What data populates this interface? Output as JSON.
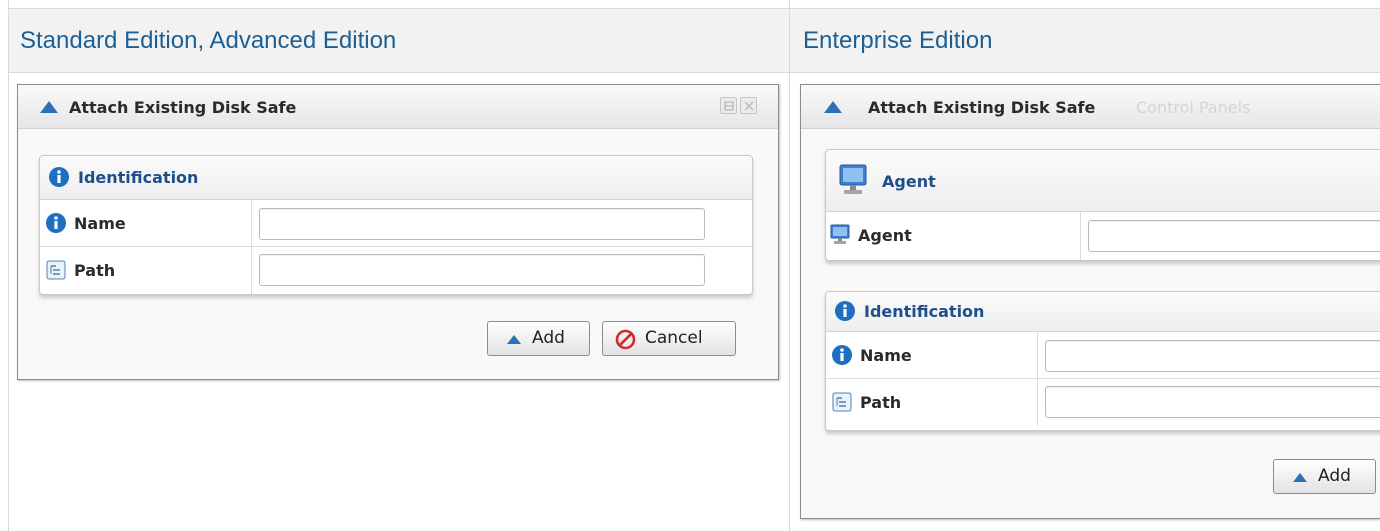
{
  "columns": [
    {
      "header": "Standard Edition, Advanced Edition",
      "dialog": {
        "title": "Attach Existing Disk Safe",
        "section": {
          "title": "Identification",
          "fields": [
            {
              "label": "Name",
              "value": "",
              "icon": "info-icon"
            },
            {
              "label": "Path",
              "value": "",
              "icon": "path-icon"
            }
          ]
        },
        "buttons": {
          "add": "Add",
          "cancel": "Cancel"
        }
      }
    },
    {
      "header": "Enterprise Edition",
      "dialog": {
        "title": "Attach Existing Disk Safe",
        "background_ghost_text": "Control Panels",
        "agent_section": {
          "title": "Agent",
          "fields": [
            {
              "label": "Agent",
              "value": "",
              "icon": "computer-icon"
            }
          ]
        },
        "section": {
          "title": "Identification",
          "fields": [
            {
              "label": "Name",
              "value": "",
              "icon": "info-icon"
            },
            {
              "label": "Path",
              "value": "",
              "icon": "path-icon"
            }
          ]
        },
        "buttons": {
          "add": "Add"
        }
      }
    }
  ],
  "colors": {
    "header_text": "#1e5f93",
    "header_bg": "#f2f2f2",
    "section_title": "#1e4f8a",
    "info_icon": "#1f6fc0",
    "cancel_icon": "#d42a2a"
  }
}
